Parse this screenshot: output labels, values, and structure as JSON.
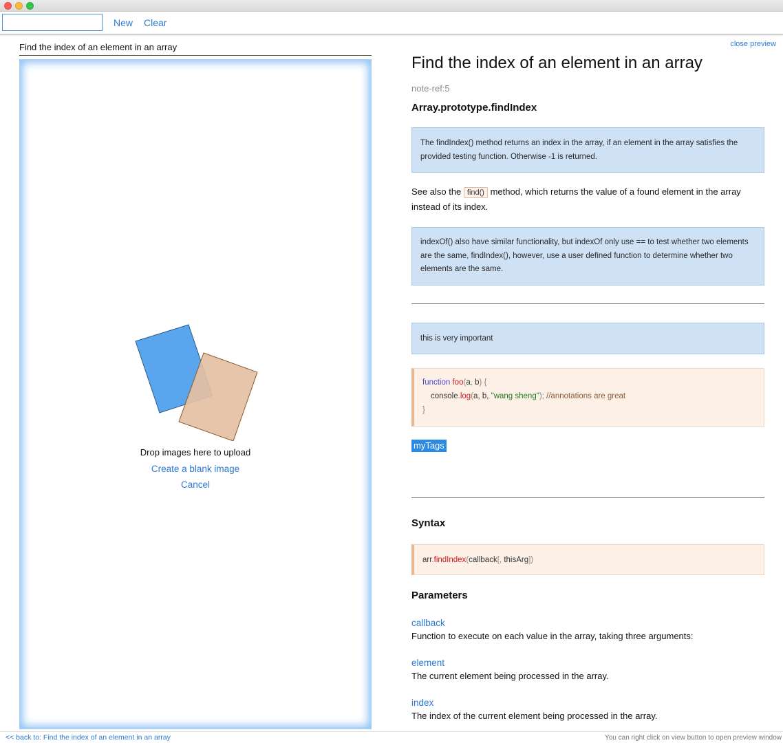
{
  "toolbar": {
    "search_value": "",
    "new_label": "New",
    "clear_label": "Clear"
  },
  "editor": {
    "note_title": "Find the index of an element in an array",
    "drop_text": "Drop images here to upload",
    "create_blank_label": "Create a blank image",
    "cancel_label": "Cancel"
  },
  "preview": {
    "close_label": "close preview",
    "title": "Find the index of an element in an array",
    "note_ref": "note-ref:5",
    "subtitle": "Array.prototype.findIndex",
    "note1": "The findIndex() method returns an index in the array, if an element in the array satisfies the provided testing function. Otherwise -1 is returned.",
    "see_also_prefix": "See also the",
    "see_also_code": "find()",
    "see_also_suffix": "method, which returns the value of a found element in the array instead of its index.",
    "note2": "indexOf() also have similar functionality, but indexOf only use == to test whether two elements are the same, findIndex(), however, use a user defined function to determine whether two elements are the same.",
    "note3": "this is very important",
    "code1": {
      "kw": "function",
      "fn_name": "foo",
      "args_open": "(",
      "arg_a": "a",
      "comma1": ", ",
      "arg_b": "b",
      "args_close": ") {",
      "indent_obj": "console",
      "dot": ".",
      "method": "log",
      "call_open": "(",
      "call_args": "a, b, ",
      "str": "\"wang sheng\"",
      "call_close": ");",
      "comment": " //annotations are great",
      "closing": "}"
    },
    "tag": "myTags",
    "syntax_heading": "Syntax",
    "syntax_code": {
      "obj": "arr",
      "dot": ".",
      "method": "findIndex",
      "open": "(",
      "arg": "callback",
      "opt_open": "[, ",
      "opt_arg": "thisArg",
      "close": "])"
    },
    "parameters_heading": "Parameters",
    "params": [
      {
        "name": "callback",
        "desc": "Function to execute on each value in the array, taking three arguments:"
      },
      {
        "name": "element",
        "desc": "The current element being processed in the array."
      },
      {
        "name": "index",
        "desc": "The index of the current element being processed in the array."
      }
    ]
  },
  "status": {
    "back_link": "<< back to: Find the index of an element in an array",
    "hint": "You can right click on view button to open preview window"
  },
  "colors": {
    "accent": "#2a7ad2",
    "note_bg": "#cfe2f5",
    "code_bg": "#fdf0e6",
    "tag_bg": "#2a8ae4",
    "drop_glow": "#8fc2f5",
    "blue_card": "#5aa6ee",
    "peach_card": "#e5c0a3"
  }
}
